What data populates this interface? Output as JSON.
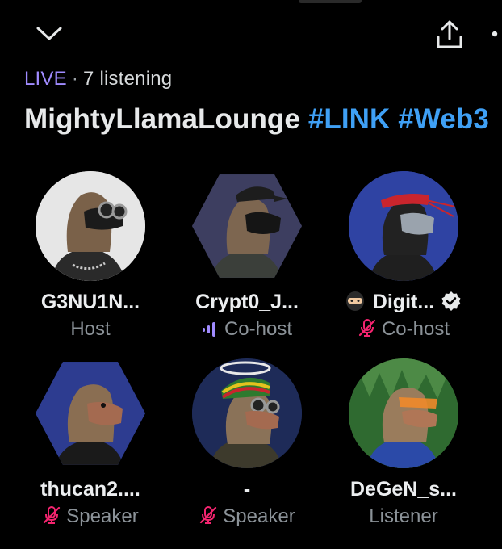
{
  "space": {
    "live_label": "LIVE",
    "separator": "·",
    "listening": "7 listening",
    "title_name": "MightyLlamaLounge",
    "title_tags": "#LINK #Web3"
  },
  "participants": [
    {
      "name": "G3NU1N...",
      "role": "Host",
      "avatar_bg": "#e8e8e8",
      "role_icon": "none"
    },
    {
      "name": "Crypt0_J...",
      "role": "Co-host",
      "avatar_bg": "#3a3b5c",
      "role_icon": "speaking-bars-icon"
    },
    {
      "name": "Digit...",
      "role": "Co-host",
      "avatar_bg": "#2c3f9a",
      "role_icon": "mic-off-icon",
      "verified": true,
      "emoji": "ninja"
    },
    {
      "name": "thucan2....",
      "role": "Speaker",
      "avatar_bg": "#2a3a8c",
      "role_icon": "mic-off-icon"
    },
    {
      "name": "-",
      "role": "Speaker",
      "avatar_bg": "#1c2a55",
      "role_icon": "mic-off-icon"
    },
    {
      "name": "DeGeN_s...",
      "role": "Listener",
      "avatar_bg": "#3f7a3a",
      "role_icon": "none"
    }
  ],
  "colors": {
    "accent_live": "#a08bff",
    "hashtag": "#3fa0f5",
    "mic_off": "#f4246f",
    "speaking": "#a08bff"
  }
}
